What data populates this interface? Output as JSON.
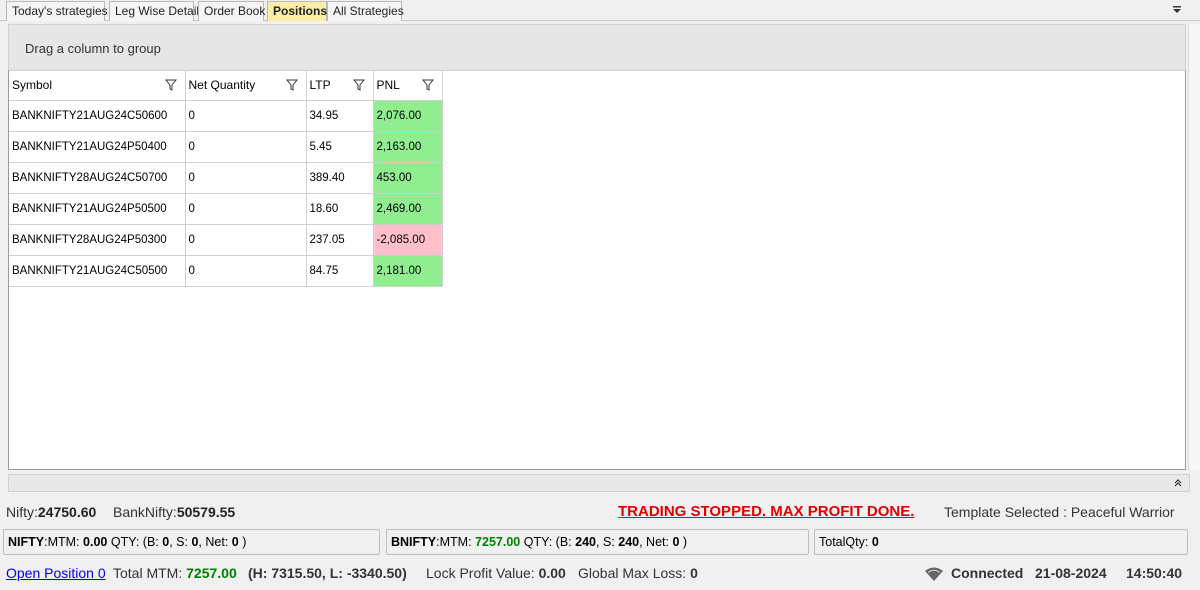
{
  "tabs": [
    {
      "label": "Today's strategies",
      "active": false
    },
    {
      "label": "Leg Wise Detail",
      "active": false
    },
    {
      "label": "Order Book",
      "active": false
    },
    {
      "label": "Positions",
      "active": true
    },
    {
      "label": "All Strategies",
      "active": false
    }
  ],
  "group_panel": {
    "hint": "Drag a column to group"
  },
  "grid": {
    "columns": [
      "Symbol",
      "Net Quantity",
      "LTP",
      "PNL"
    ],
    "rows": [
      {
        "symbol": "BANKNIFTY21AUG24C50600",
        "net_quantity": "0",
        "ltp": "34.95",
        "pnl": "2,076.00",
        "pnl_status": "positive"
      },
      {
        "symbol": "BANKNIFTY21AUG24P50400",
        "net_quantity": "0",
        "ltp": "5.45",
        "pnl": "2,163.00",
        "pnl_status": "positive"
      },
      {
        "symbol": "BANKNIFTY28AUG24C50700",
        "net_quantity": "0",
        "ltp": "389.40",
        "pnl": "453.00",
        "pnl_status": "positive"
      },
      {
        "symbol": "BANKNIFTY21AUG24P50500",
        "net_quantity": "0",
        "ltp": "18.60",
        "pnl": "2,469.00",
        "pnl_status": "positive"
      },
      {
        "symbol": "BANKNIFTY28AUG24P50300",
        "net_quantity": "0",
        "ltp": "237.05",
        "pnl": "-2,085.00",
        "pnl_status": "negative"
      },
      {
        "symbol": "BANKNIFTY21AUG24C50500",
        "net_quantity": "0",
        "ltp": "84.75",
        "pnl": "2,181.00",
        "pnl_status": "positive"
      }
    ]
  },
  "ticker": {
    "nifty_label": "Nifty:",
    "nifty_value": "24750.60",
    "banknifty_label": "BankNifty:",
    "banknifty_value": "50579.55",
    "warning": "TRADING STOPPED. MAX PROFIT DONE.",
    "template": "Template Selected : Peaceful Warrior"
  },
  "panels": {
    "nifty": {
      "name": "NIFTY",
      "mtm_label": ":MTM:",
      "mtm": "0.00",
      "qty_label": "QTY: (B:",
      "b": "0",
      "s_label": ", S:",
      "s": "0",
      "net_label": ", Net:",
      "net": "0",
      "close": ")"
    },
    "bnifty": {
      "name": "BNIFTY",
      "mtm_label": ":MTM:",
      "mtm": "7257.00",
      "qty_label": "QTY: (B:",
      "b": "240",
      "s_label": ", S:",
      "s": "240",
      "net_label": ", Net:",
      "net": "0",
      "close": ")"
    },
    "total_qty": {
      "label": "TotalQty:",
      "value": "0"
    }
  },
  "status": {
    "open_position": "Open Position 0",
    "total_mtm_label": "Total MTM:",
    "total_mtm": "7257.00",
    "hl": "(H: 7315.50, L: -3340.50)",
    "lock_profit_label": "Lock Profit Value:",
    "lock_profit": "0.00",
    "global_max_loss_label": "Global Max Loss:",
    "global_max_loss": "0",
    "connection": "Connected",
    "date": "21-08-2024",
    "time": "14:50:40"
  },
  "colors": {
    "pnl_positive": "#90ee90",
    "pnl_negative": "#ffc0cb",
    "warning": "#e00000",
    "active_tab": "#fdeea6",
    "mtm_green": "#008000"
  }
}
